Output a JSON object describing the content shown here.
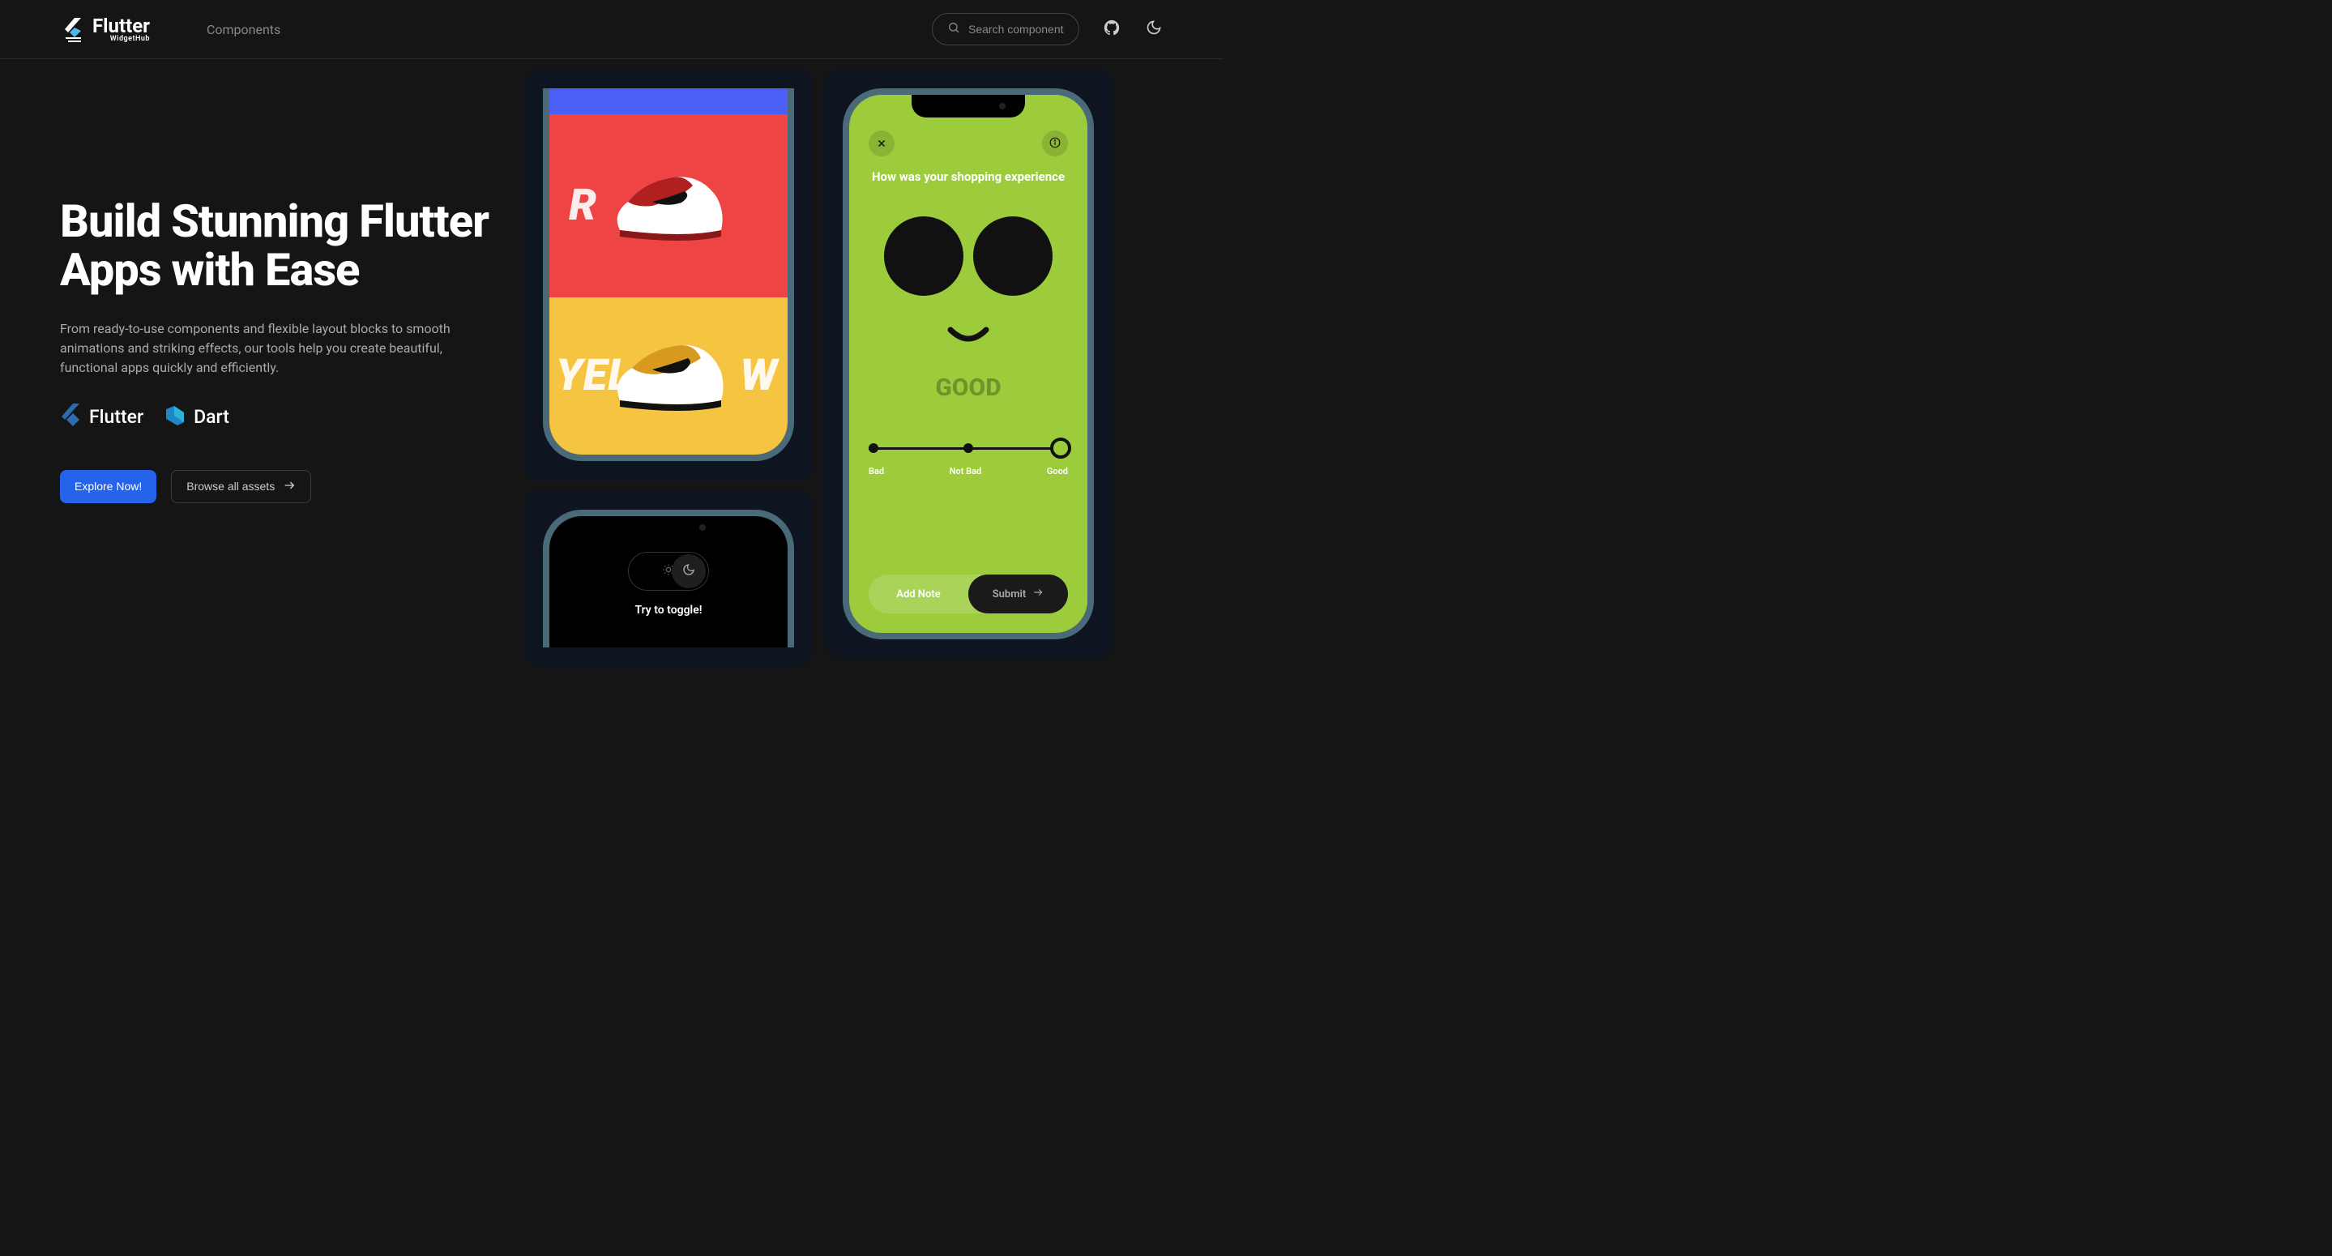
{
  "header": {
    "logo": {
      "main": "Flutter",
      "sub": "WidgetHub"
    },
    "nav": {
      "components": "Components"
    },
    "search": {
      "placeholder": "Search component..."
    }
  },
  "hero": {
    "title": "Build Stunning Flutter Apps with Ease",
    "description": "From ready-to-use components and flexible layout blocks to smooth animations and striking effects, our tools help you create beautiful, functional apps quickly and efficiently.",
    "tech": {
      "flutter": "Flutter",
      "dart": "Dart"
    },
    "cta_primary": "Explore Now!",
    "cta_secondary": "Browse all assets"
  },
  "previews": {
    "shoes": {
      "red_label": "R",
      "yellow_label_left": "YEL",
      "yellow_label_right": "W"
    },
    "toggle": {
      "label": "Try to toggle!"
    },
    "feedback": {
      "question": "How was your shopping experience",
      "mood": "GOOD",
      "slider": {
        "left": "Bad",
        "mid": "Not Bad",
        "right": "Good"
      },
      "add_note": "Add Note",
      "submit": "Submit"
    }
  }
}
